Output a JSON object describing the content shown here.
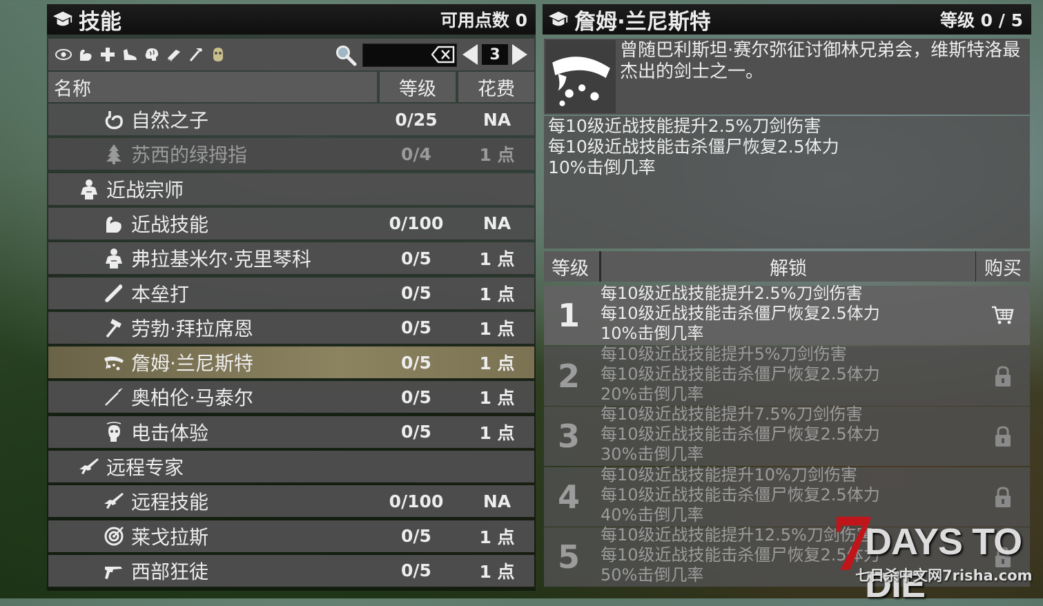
{
  "left_header": {
    "title": "技能",
    "points_label": "可用点数 0"
  },
  "right_header": {
    "title": "詹姆·兰尼斯特",
    "level_label": "等级 0 / 5"
  },
  "toolbar": {
    "filter_icons": [
      "eye-icon",
      "arm-icon",
      "plus-icon",
      "shoe-icon",
      "brain-icon",
      "book-icon",
      "hammer-icon",
      "mask-icon"
    ],
    "search_value": "",
    "page": "3"
  },
  "columns": {
    "name": "名称",
    "level": "等级",
    "cost": "花费"
  },
  "skills": [
    {
      "icon": "stomach-icon",
      "name": "自然之子",
      "level": "0/25",
      "cost": "NA",
      "indent": 2,
      "state": "normal"
    },
    {
      "icon": "tree-icon",
      "name": "苏西的绿拇指",
      "level": "0/4",
      "cost": "1 点",
      "indent": 2,
      "state": "locked"
    },
    {
      "icon": "fighter-icon",
      "name": "近战宗师",
      "level": "",
      "cost": "",
      "indent": 1,
      "state": "normal"
    },
    {
      "icon": "arm-icon",
      "name": "近战技能",
      "level": "0/100",
      "cost": "NA",
      "indent": 2,
      "state": "normal"
    },
    {
      "icon": "fighter-icon",
      "name": "弗拉基米尔·克里琴科",
      "level": "0/5",
      "cost": "1 点",
      "indent": 2,
      "state": "normal"
    },
    {
      "icon": "bat-icon",
      "name": "本垒打",
      "level": "0/5",
      "cost": "1 点",
      "indent": 2,
      "state": "normal"
    },
    {
      "icon": "sledgehammer-icon",
      "name": "劳勃·拜拉席恩",
      "level": "0/5",
      "cost": "1 点",
      "indent": 2,
      "state": "normal"
    },
    {
      "icon": "bleeding-blade-icon",
      "name": "詹姆·兰尼斯特",
      "level": "0/5",
      "cost": "1 点",
      "indent": 2,
      "state": "selected"
    },
    {
      "icon": "spear-icon",
      "name": "奥柏伦·马泰尔",
      "level": "0/5",
      "cost": "1 点",
      "indent": 2,
      "state": "normal"
    },
    {
      "icon": "dizzy-head-icon",
      "name": "电击体验",
      "level": "0/5",
      "cost": "1 点",
      "indent": 2,
      "state": "normal"
    },
    {
      "icon": "rifle-icon",
      "name": "远程专家",
      "level": "",
      "cost": "",
      "indent": 1,
      "state": "normal"
    },
    {
      "icon": "rifle-icon",
      "name": "远程技能",
      "level": "0/100",
      "cost": "NA",
      "indent": 2,
      "state": "normal"
    },
    {
      "icon": "target-icon",
      "name": "莱戈拉斯",
      "level": "0/5",
      "cost": "1 点",
      "indent": 2,
      "state": "normal"
    },
    {
      "icon": "revolver-icon",
      "name": "西部狂徒",
      "level": "0/5",
      "cost": "1 点",
      "indent": 2,
      "state": "normal"
    }
  ],
  "detail": {
    "description": "曾随巴利斯坦·赛尔弥征讨御林兄弟会，维斯特洛最杰出的剑士之一。",
    "effects": [
      "每10级近战技能提升2.5%刀剑伤害",
      "每10级近战技能击杀僵尸恢复2.5体力",
      "10%击倒几率"
    ],
    "table_headers": {
      "level": "等级",
      "unlock": "解锁",
      "buy": "购买"
    },
    "levels": [
      {
        "n": "1",
        "lines": [
          "每10级近战技能提升2.5%刀剑伤害",
          "每10级近战技能击杀僵尸恢复2.5体力",
          "10%击倒几率"
        ],
        "action": "cart-icon"
      },
      {
        "n": "2",
        "lines": [
          "每10级近战技能提升5%刀剑伤害",
          "每10级近战技能击杀僵尸恢复2.5体力",
          "20%击倒几率"
        ],
        "action": "lock-icon"
      },
      {
        "n": "3",
        "lines": [
          "每10级近战技能提升7.5%刀剑伤害",
          "每10级近战技能击杀僵尸恢复2.5体力",
          "30%击倒几率"
        ],
        "action": "lock-icon"
      },
      {
        "n": "4",
        "lines": [
          "每10级近战技能提升10%刀剑伤害",
          "每10级近战技能击杀僵尸恢复2.5体力",
          "40%击倒几率"
        ],
        "action": "lock-icon"
      },
      {
        "n": "5",
        "lines": [
          "每10级近战技能提升12.5%刀剑伤害",
          "每10级近战技能击杀僵尸恢复2.5体力",
          "50%击倒几率"
        ],
        "action": "lock-icon"
      }
    ]
  },
  "watermark": {
    "logo_number": "7",
    "logo_text": "DAYS TO DIE",
    "site": "七日杀中文网7risha.com"
  }
}
